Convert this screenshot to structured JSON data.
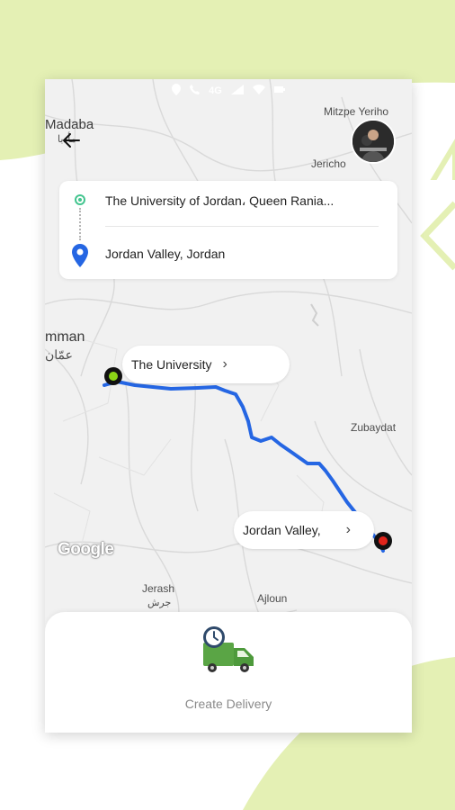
{
  "status_bar": {
    "network": "4G"
  },
  "map": {
    "labels": {
      "madaba": "Madaba",
      "madaba_ar": "مأدبا",
      "mitzpe": "Mitzpe Yeriho",
      "jericho": "Jericho",
      "amman": "mman",
      "amman_ar": "عمّان",
      "zubaydat": "Zubaydat",
      "jerash": "Jerash",
      "jerash_ar": "جرش",
      "ajloun": "Ajloun"
    },
    "google": "Google",
    "route_color": "#2566e3"
  },
  "route_card": {
    "origin": "The University of Jordan، Queen Rania...",
    "destination": "Jordan Valley, Jordan"
  },
  "markers": {
    "start_label": "The University",
    "end_label": "Jordan Valley,"
  },
  "bottom_sheet": {
    "action_label": "Create Delivery"
  },
  "colors": {
    "accent_lime": "#e4f0b4",
    "origin_green": "#43c58f",
    "pin_blue": "#2566e3",
    "start_marker": "#8bd416",
    "end_marker": "#e0241b",
    "truck_green": "#5aa545"
  }
}
